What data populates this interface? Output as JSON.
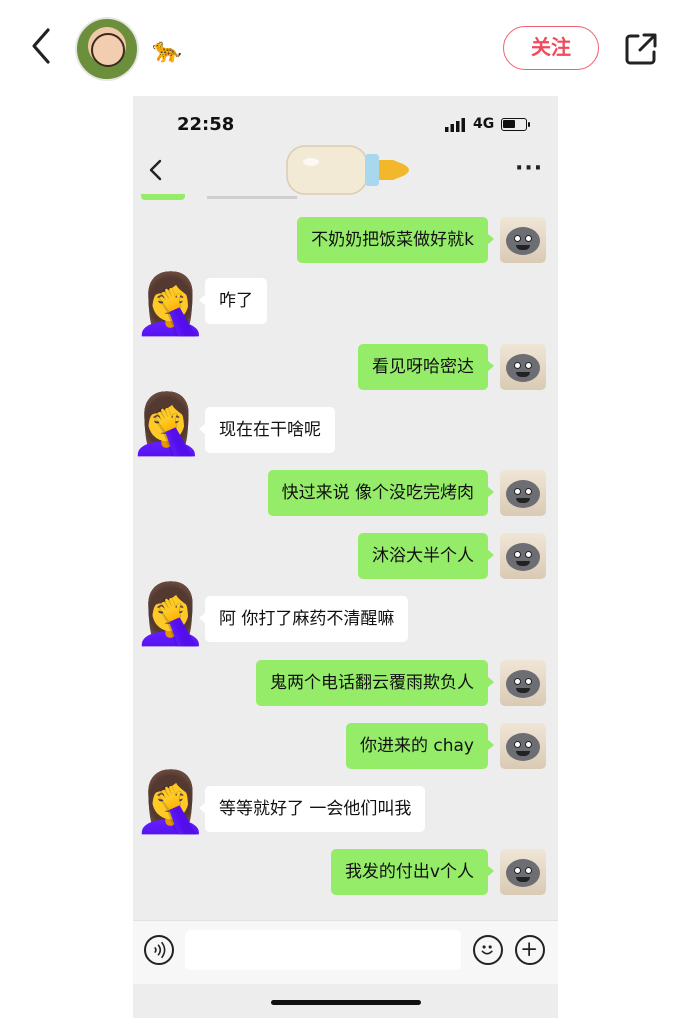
{
  "app": {
    "follow_label": "关注",
    "username_emoji": "🐆"
  },
  "phone": {
    "time": "22:58",
    "network": "4G"
  },
  "chat": {
    "header_sticker": "bottle-icon",
    "messages": [
      {
        "side": "me",
        "text": "不奶奶把饭菜做好就k"
      },
      {
        "side": "them",
        "text": "咋了"
      },
      {
        "side": "me",
        "text": "看见呀哈密达"
      },
      {
        "side": "them",
        "text": "现在在干啥呢"
      },
      {
        "side": "me",
        "text": "快过来说  像个没吃完烤肉"
      },
      {
        "side": "me",
        "text": "沐浴大半个人"
      },
      {
        "side": "them",
        "text": "阿 你打了麻药不清醒嘛"
      },
      {
        "side": "me",
        "text": "鬼两个电话翻云覆雨欺负人"
      },
      {
        "side": "me",
        "text": "你进来的 chay"
      },
      {
        "side": "them",
        "text": "等等就好了 一会他们叫我"
      },
      {
        "side": "me",
        "text": "我发的付出v个人"
      }
    ]
  },
  "colors": {
    "me_bubble": "#95ec69",
    "them_bubble": "#ffffff",
    "chat_bg": "#ededed",
    "follow_accent": "#f04a5c"
  }
}
